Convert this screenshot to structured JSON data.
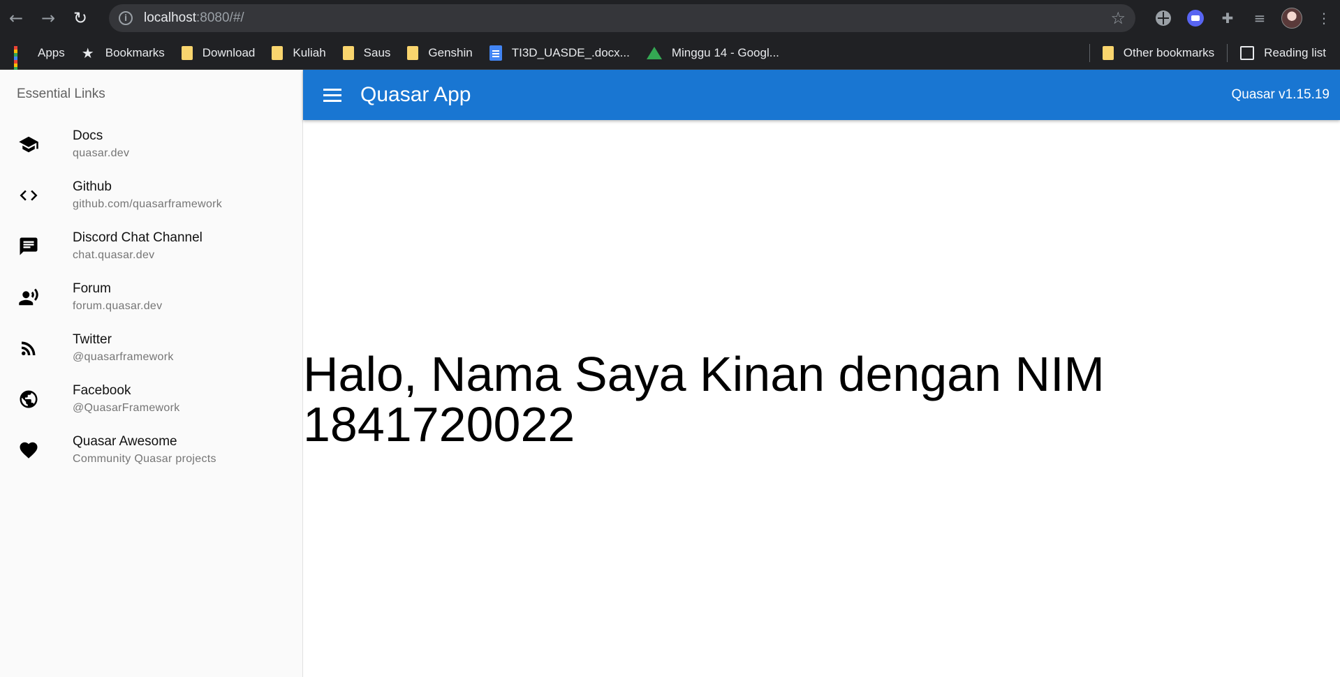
{
  "browser": {
    "url_host": "localhost",
    "url_path": ":8080/#/",
    "bookmarks": [
      {
        "label": "Apps",
        "icon": "apps-grid-icon"
      },
      {
        "label": "Bookmarks",
        "icon": "star-icon"
      },
      {
        "label": "Download",
        "icon": "folder-icon"
      },
      {
        "label": "Kuliah",
        "icon": "folder-icon"
      },
      {
        "label": "Saus",
        "icon": "folder-icon"
      },
      {
        "label": "Genshin",
        "icon": "folder-icon"
      },
      {
        "label": "TI3D_UASDE_.docx...",
        "icon": "google-docs-icon"
      },
      {
        "label": "Minggu 14 - Googl...",
        "icon": "google-drive-icon"
      }
    ],
    "other_bookmarks": "Other bookmarks",
    "reading_list": "Reading list"
  },
  "drawer": {
    "header": "Essential Links",
    "links": [
      {
        "title": "Docs",
        "caption": "quasar.dev",
        "icon": "school-icon"
      },
      {
        "title": "Github",
        "caption": "github.com/quasarframework",
        "icon": "code-icon"
      },
      {
        "title": "Discord Chat Channel",
        "caption": "chat.quasar.dev",
        "icon": "chat-icon"
      },
      {
        "title": "Forum",
        "caption": "forum.quasar.dev",
        "icon": "record-voice-icon"
      },
      {
        "title": "Twitter",
        "caption": "@quasarframework",
        "icon": "rss-feed-icon"
      },
      {
        "title": "Facebook",
        "caption": "@QuasarFramework",
        "icon": "public-icon"
      },
      {
        "title": "Quasar Awesome",
        "caption": "Community Quasar projects",
        "icon": "favorite-icon"
      }
    ]
  },
  "header": {
    "title": "Quasar App",
    "version": "Quasar v1.15.19"
  },
  "main": {
    "greeting": "Halo, Nama Saya Kinan dengan NIM 1841720022"
  },
  "colors": {
    "primary": "#1976d2",
    "chrome_bg": "#202124"
  }
}
